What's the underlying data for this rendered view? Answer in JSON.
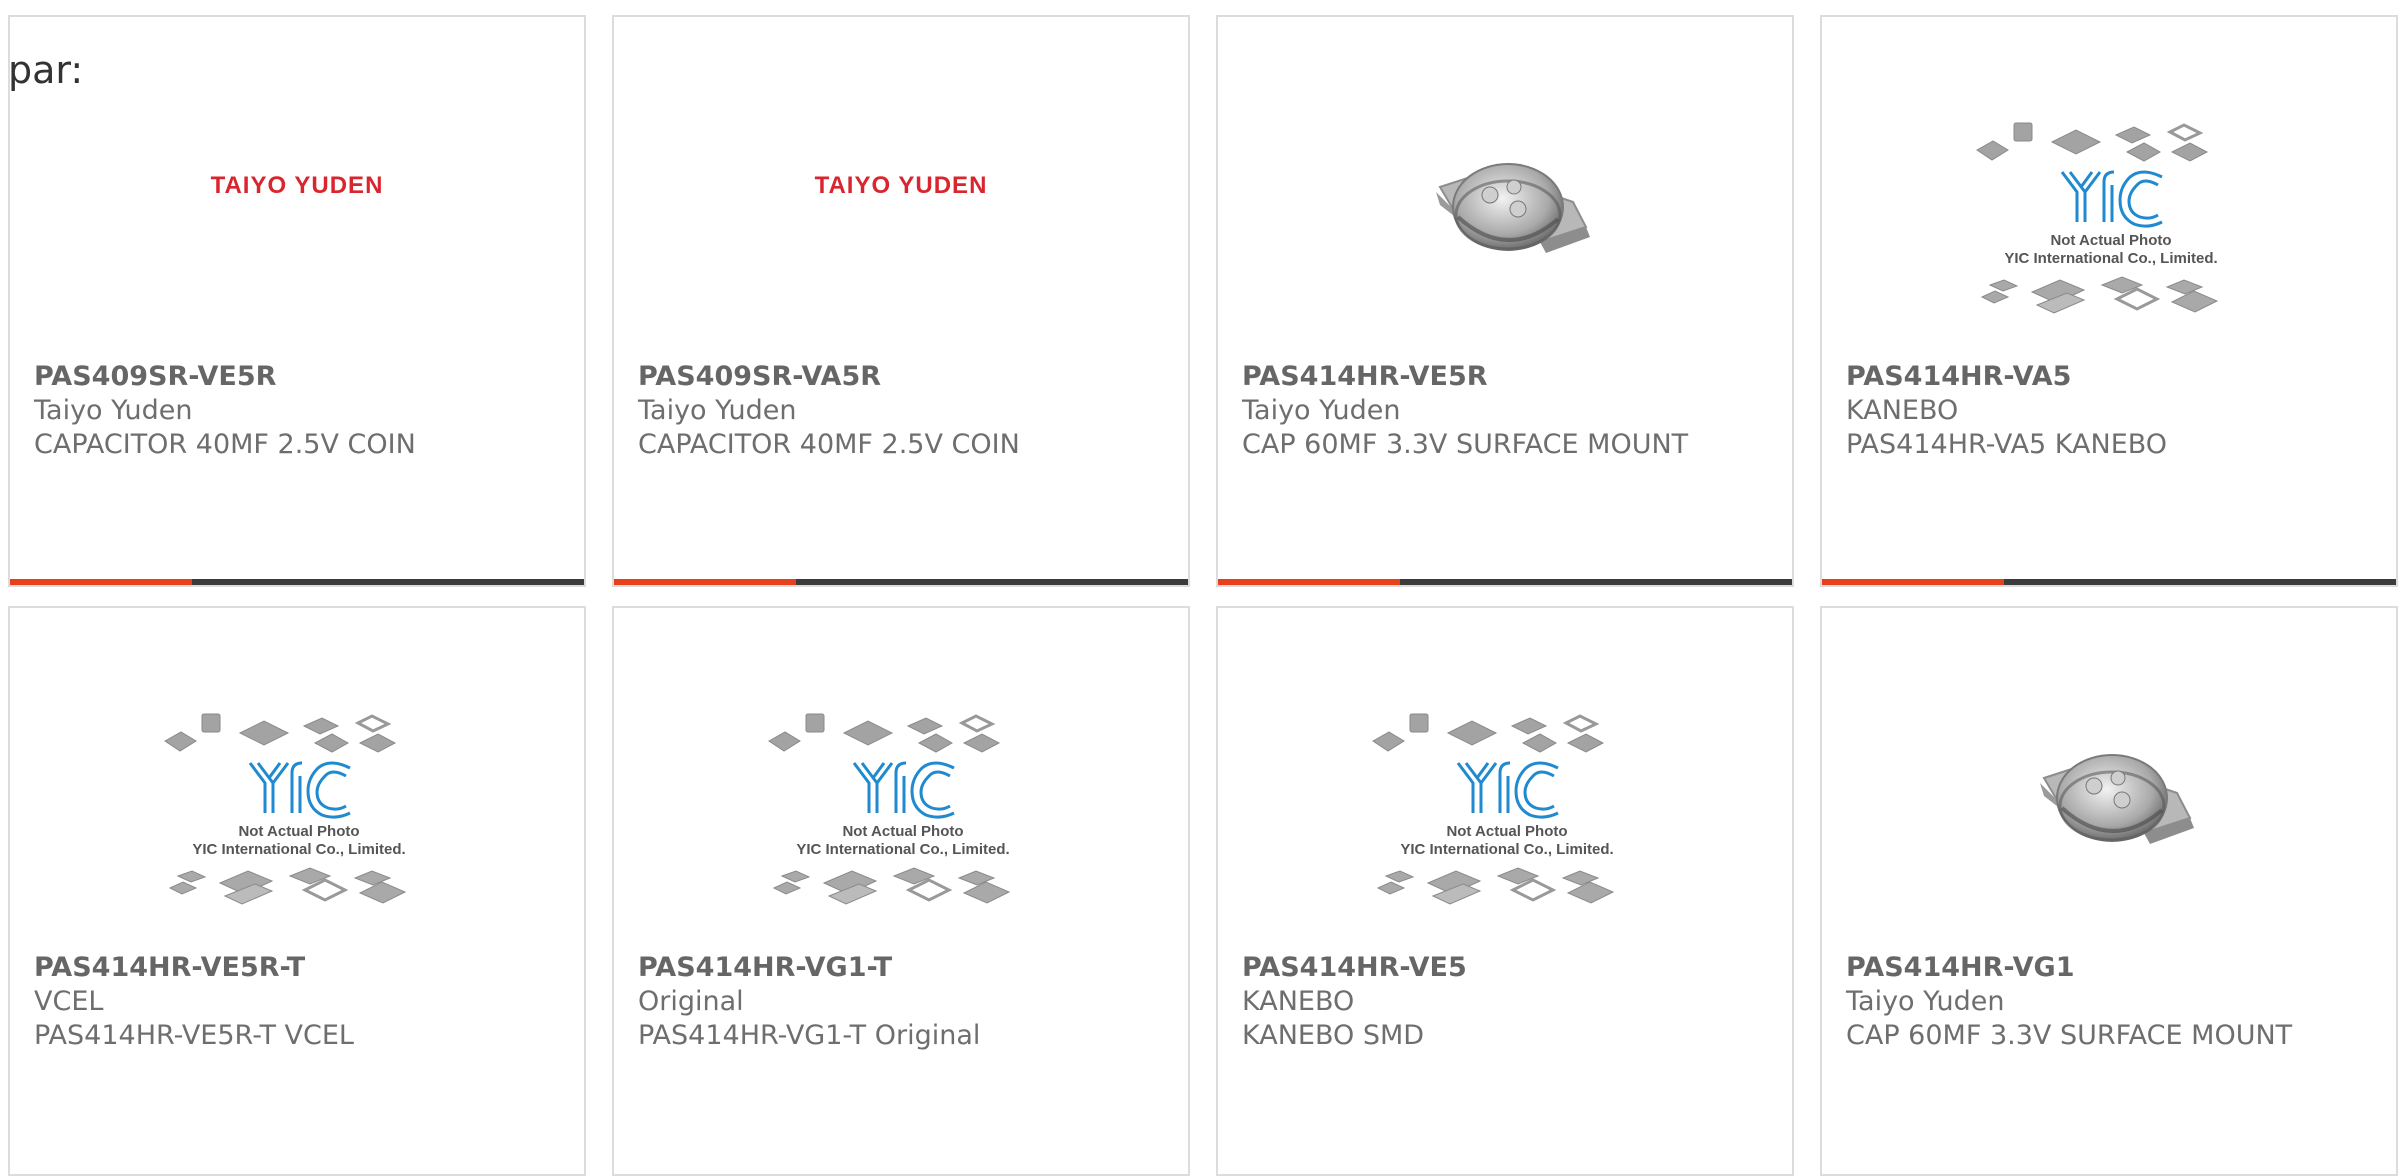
{
  "page_label": "par:",
  "placeholder": {
    "line1": "Not Actual Photo",
    "line2": "YIC International Co., Limited."
  },
  "colors": {
    "accent": "#e8401c",
    "bar": "#3b3b3b",
    "brand_logo": "#d9262e",
    "text": "#666666"
  },
  "products": [
    {
      "part": "PAS409SR-VE5R",
      "brand": "Taiyo Yuden",
      "desc": "CAPACITOR 40MF 2.5V COIN",
      "image": "taiyo-yuden-logo",
      "logo_text": "TAIYO YUDEN"
    },
    {
      "part": "PAS409SR-VA5R",
      "brand": "Taiyo Yuden",
      "desc": "CAPACITOR 40MF 2.5V COIN",
      "image": "taiyo-yuden-logo",
      "logo_text": "TAIYO YUDEN"
    },
    {
      "part": "PAS414HR-VE5R",
      "brand": "Taiyo Yuden",
      "desc": "CAP 60MF 3.3V SURFACE MOUNT",
      "image": "coin-capacitor-photo"
    },
    {
      "part": "PAS414HR-VA5",
      "brand": "KANEBO",
      "desc": "PAS414HR-VA5 KANEBO",
      "image": "yic-placeholder"
    },
    {
      "part": "PAS414HR-VE5R-T",
      "brand": "VCEL",
      "desc": "PAS414HR-VE5R-T VCEL",
      "image": "yic-placeholder"
    },
    {
      "part": "PAS414HR-VG1-T",
      "brand": "Original",
      "desc": "PAS414HR-VG1-T Original",
      "image": "yic-placeholder"
    },
    {
      "part": "PAS414HR-VE5",
      "brand": "KANEBO",
      "desc": "KANEBO SMD",
      "image": "yic-placeholder"
    },
    {
      "part": "PAS414HR-VG1",
      "brand": "Taiyo Yuden",
      "desc": "CAP 60MF 3.3V SURFACE MOUNT",
      "image": "coin-capacitor-photo"
    }
  ]
}
